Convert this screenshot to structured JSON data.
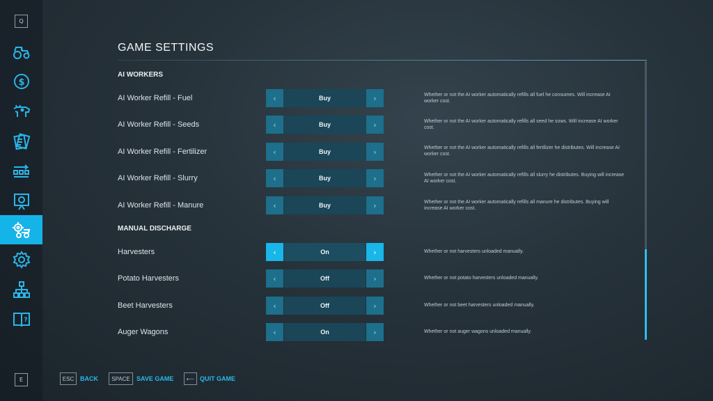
{
  "sidebar": {
    "top_key": "Q",
    "bottom_key": "E",
    "items": [
      {
        "icon": "tractor-icon"
      },
      {
        "icon": "dollar-icon"
      },
      {
        "icon": "cow-icon"
      },
      {
        "icon": "contracts-icon"
      },
      {
        "icon": "production-chain-icon"
      },
      {
        "icon": "statistics-icon"
      },
      {
        "icon": "farm-settings-icon",
        "active": true
      },
      {
        "icon": "gear-icon"
      },
      {
        "icon": "hierarchy-icon"
      },
      {
        "icon": "help-book-icon"
      }
    ],
    "accent_color": "#15b4e8"
  },
  "page": {
    "title": "GAME SETTINGS"
  },
  "sections": {
    "ai_workers": {
      "title": "AI WORKERS",
      "rows": [
        {
          "label": "AI Worker Refill - Fuel",
          "value": "Buy",
          "description": "Whether or not the AI worker automatically refills all fuel he consumes. Will increase AI worker cost."
        },
        {
          "label": "AI Worker Refill - Seeds",
          "value": "Buy",
          "description": "Whether or not the AI worker automatically refills all seed he sows. Will increase AI worker cost."
        },
        {
          "label": "AI Worker Refill - Fertilizer",
          "value": "Buy",
          "description": "Whether or not the AI worker automatically refills all fertilizer he distributes. Will increase AI worker cost."
        },
        {
          "label": "AI Worker Refill - Slurry",
          "value": "Buy",
          "description": "Whether or not the AI worker automatically refills all slurry he distributes. Buying will increase AI worker cost."
        },
        {
          "label": "AI Worker Refill - Manure",
          "value": "Buy",
          "description": "Whether or not the AI worker automatically refills all manure he distributes. Buying will increase AI worker cost."
        }
      ]
    },
    "manual_discharge": {
      "title": "MANUAL DISCHARGE",
      "rows": [
        {
          "label": "Harvesters",
          "value": "On",
          "description": "Whether or not harvesters unloaded manually.",
          "focused": true
        },
        {
          "label": "Potato Harvesters",
          "value": "Off",
          "description": "Whether or not potato harvesters unloaded manually."
        },
        {
          "label": "Beet Harvesters",
          "value": "Off",
          "description": "Whether or not beet harvesters unloaded manually."
        },
        {
          "label": "Auger Wagons",
          "value": "On",
          "description": "Whether or not auger wagons unloaded manually."
        }
      ]
    }
  },
  "arrows": {
    "left": "‹",
    "right": "›"
  },
  "footer": {
    "back": {
      "key": "ESC",
      "label": "BACK"
    },
    "save": {
      "key": "SPACE",
      "label": "SAVE GAME"
    },
    "quit": {
      "key": "⟵",
      "label": "QUIT GAME"
    }
  }
}
